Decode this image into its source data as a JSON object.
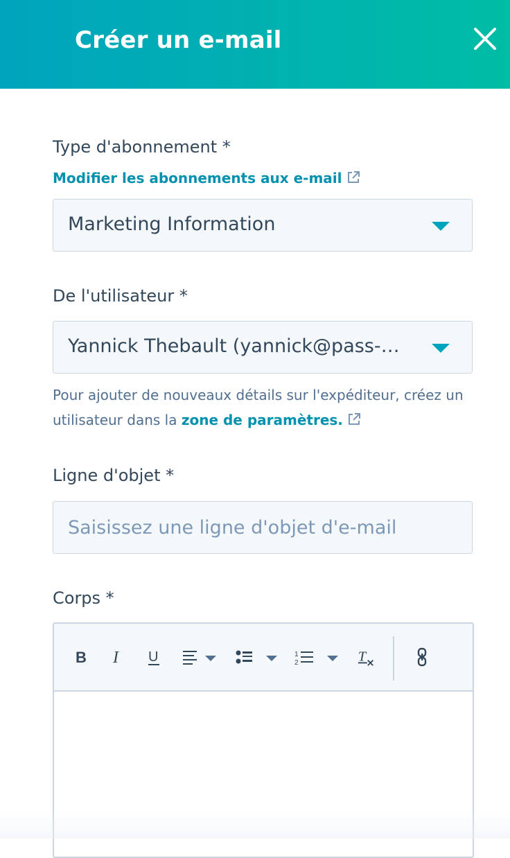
{
  "header": {
    "title": "Créer un e-mail"
  },
  "subscription": {
    "label": "Type d'abonnement *",
    "edit_link": "Modifier les abonnements aux e-mail",
    "selected": "Marketing Information"
  },
  "from_user": {
    "label": "De l'utilisateur *",
    "selected": "Yannick Thebault (yannick@pass-…",
    "help_prefix": "Pour ajouter de nouveaux détails sur l'expéditeur, créez un utilisateur dans la ",
    "help_link": "zone de paramètres."
  },
  "subject": {
    "label": "Ligne d'objet *",
    "placeholder": "Saisissez une ligne d'objet d'e-mail",
    "value": ""
  },
  "body": {
    "label": "Corps *",
    "toolbar": [
      "bold-icon",
      "italic-icon",
      "underline-icon",
      "align-icon",
      "bullet-list-icon",
      "numbered-list-icon",
      "clear-format-icon",
      "link-icon"
    ]
  },
  "colors": {
    "accent": "#00a4bd",
    "header_gradient_end": "#00bda5",
    "link": "#0091ae",
    "text": "#33475b"
  }
}
